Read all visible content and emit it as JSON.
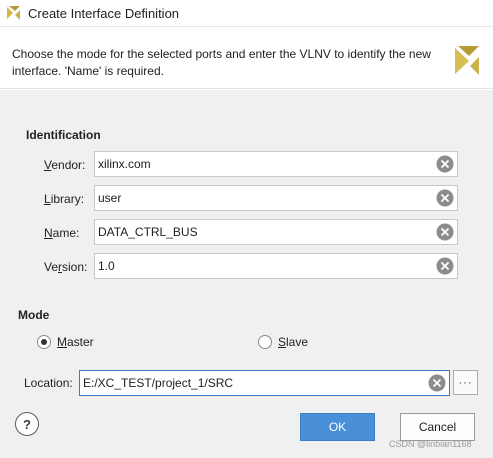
{
  "window": {
    "title": "Create Interface Definition"
  },
  "header": {
    "description": "Choose the mode for the selected ports and enter the VLNV to identify the new interface. 'Name' is required."
  },
  "identification": {
    "title": "Identification",
    "vendor": {
      "label_u": "V",
      "label_rest": "endor:",
      "value": "xilinx.com"
    },
    "library": {
      "label_u": "L",
      "label_rest": "ibrary:",
      "value": "user"
    },
    "name": {
      "label_u": "N",
      "label_rest": "ame:",
      "value": "DATA_CTRL_BUS"
    },
    "version": {
      "label_pre": "Ve",
      "label_u": "r",
      "label_rest": "sion:",
      "value": "1.0"
    }
  },
  "mode": {
    "title": "Mode",
    "master": {
      "label_u": "M",
      "label_rest": "aster",
      "checked": true
    },
    "slave": {
      "label_u": "S",
      "label_rest": "lave",
      "checked": false
    }
  },
  "location": {
    "label": "Location:",
    "value": "E:/XC_TEST/project_1/SRC",
    "browse_label": "···"
  },
  "buttons": {
    "help": "?",
    "ok": "OK",
    "cancel": "Cancel"
  },
  "watermark": "CSDN @linbian1168",
  "colors": {
    "accent": "#4a90d9",
    "logo": "#c9b24a"
  },
  "icons": {
    "title": "xilinx-logo-icon",
    "header": "xilinx-logo-icon",
    "clear": "clear-circle-x-icon"
  }
}
